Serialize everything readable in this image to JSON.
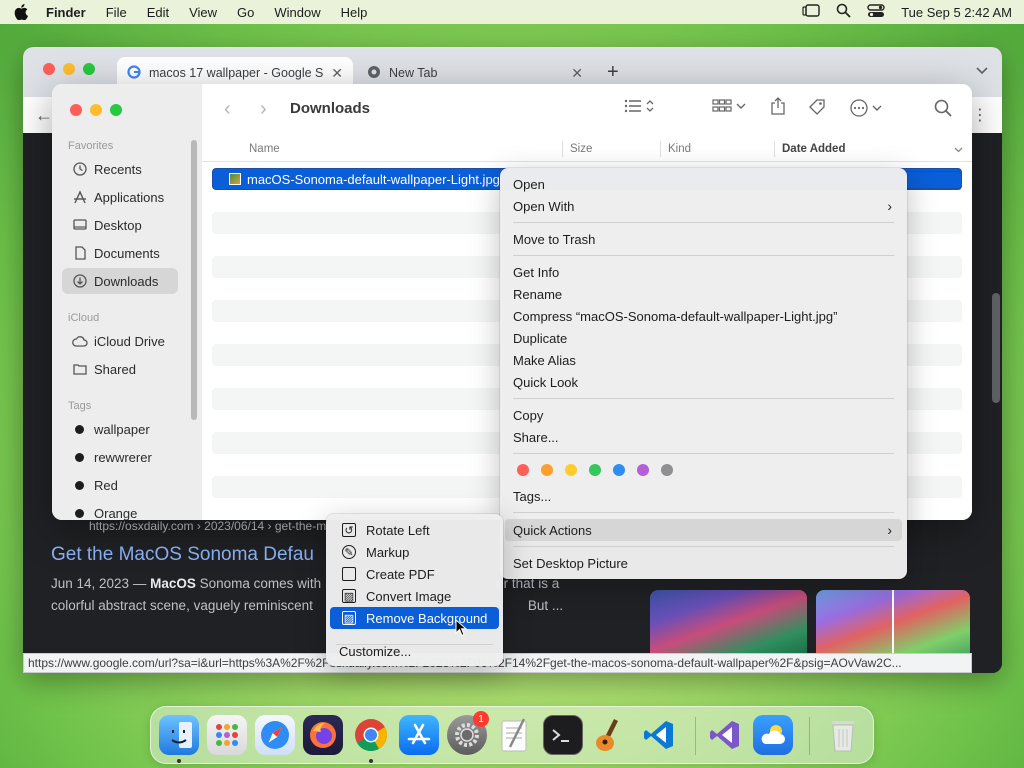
{
  "menubar": {
    "app": "Finder",
    "items": [
      "File",
      "Edit",
      "View",
      "Go",
      "Window",
      "Help"
    ],
    "clock": "Tue Sep 5  2:42 AM"
  },
  "chrome": {
    "tabs": [
      {
        "title": "macos 17 wallpaper - Google S",
        "active": true
      },
      {
        "title": "New Tab",
        "active": false
      }
    ],
    "status_url": "https://www.google.com/url?sa=i&url=https%3A%2F%2Fosxdaily.com%2F2023%2F06%2F14%2Fget-the-macos-sonoma-default-wallpaper%2F&psig=AOvVaw2C...",
    "result": {
      "cite": "https://osxdaily.com › 2023/06/14 › get-the-m",
      "title": "Get the MacOS Sonoma Defau",
      "snippet_date": "Jun 14, 2023 — ",
      "snippet_bold": "MacOS",
      "snippet_rest": " Sonoma comes with",
      "snippet_tail1": "er that is a",
      "snippet_line2": "colorful abstract scene, vaguely reminiscent",
      "snippet_tail2": "But ..."
    }
  },
  "finder": {
    "title": "Downloads",
    "sidebar": {
      "favorites_label": "Favorites",
      "favorites": [
        "Recents",
        "Applications",
        "Desktop",
        "Documents",
        "Downloads"
      ],
      "icloud_label": "iCloud",
      "icloud": [
        "iCloud Drive",
        "Shared"
      ],
      "tags_label": "Tags",
      "tags": [
        "wallpaper",
        "rewwrerer",
        "Red",
        "Orange"
      ]
    },
    "columns": {
      "name": "Name",
      "size": "Size",
      "kind": "Kind",
      "date_added": "Date Added"
    },
    "selected_file": "macOS-Sonoma-default-wallpaper-Light.jpg"
  },
  "context_menu": {
    "open": "Open",
    "open_with": "Open With",
    "move_to_trash": "Move to Trash",
    "get_info": "Get Info",
    "rename": "Rename",
    "compress": "Compress “macOS-Sonoma-default-wallpaper-Light.jpg”",
    "duplicate": "Duplicate",
    "make_alias": "Make Alias",
    "quick_look": "Quick Look",
    "copy": "Copy",
    "share": "Share...",
    "tag_colors": [
      "#ff5f57",
      "#ff9f2e",
      "#ffcc2e",
      "#34c759",
      "#2f8cf2",
      "#b45fd6",
      "#8e8e93"
    ],
    "tags": "Tags...",
    "quick_actions": "Quick Actions",
    "set_desktop_picture": "Set Desktop Picture"
  },
  "quick_actions_menu": {
    "rotate_left": "Rotate Left",
    "markup": "Markup",
    "create_pdf": "Create PDF",
    "convert_image": "Convert Image",
    "remove_background": "Remove Background",
    "customize": "Customize..."
  },
  "dock": {
    "settings_badge": "1"
  }
}
